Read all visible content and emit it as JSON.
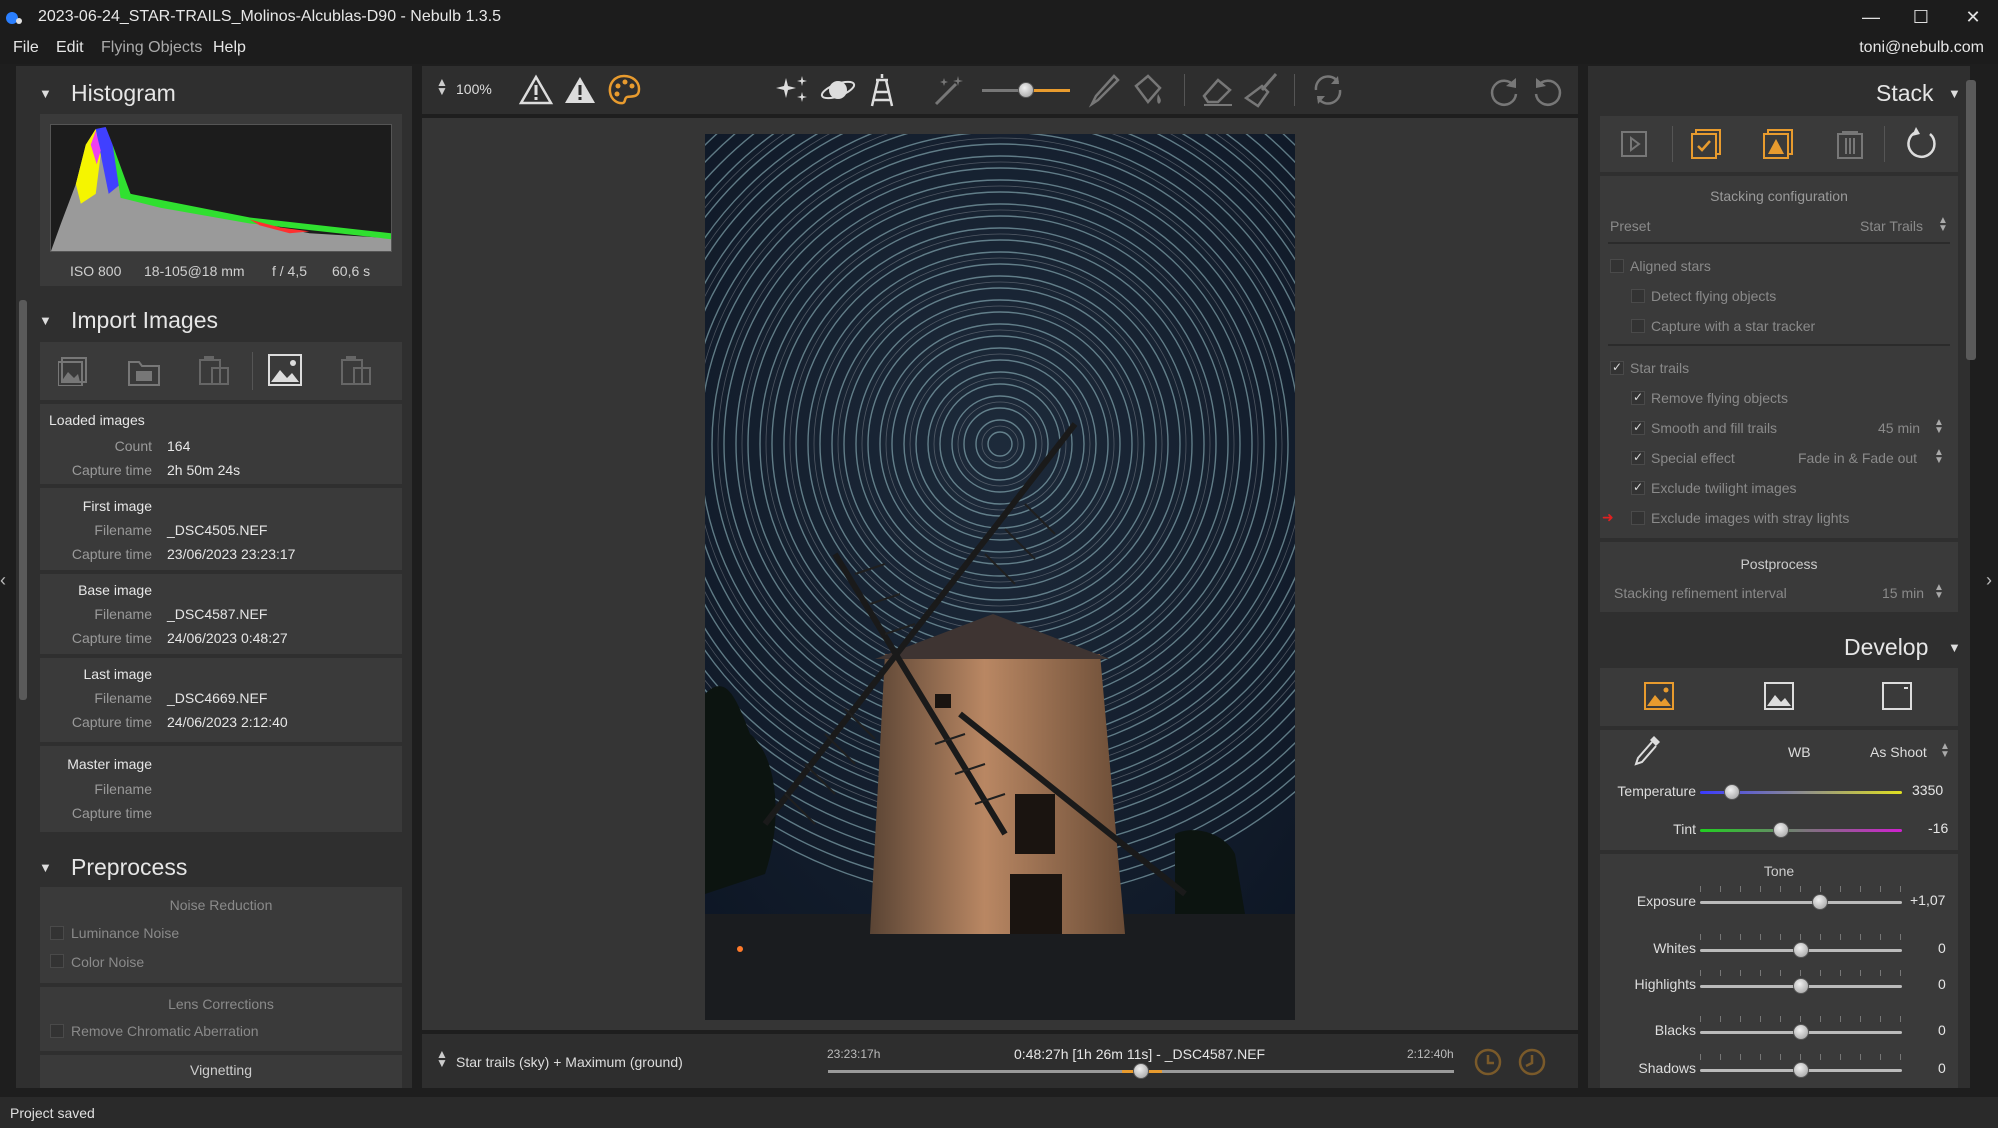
{
  "window": {
    "title": "2023-06-24_STAR-TRAILS_Molinos-Alcublas-D90 - Nebulb 1.3.5",
    "minimize": "—",
    "maximize": "☐",
    "close": "✕"
  },
  "menu": {
    "items": [
      "File",
      "Edit",
      "Flying Objects",
      "Help"
    ],
    "user": "toni@nebulb.com"
  },
  "histogram": {
    "title": "Histogram",
    "iso": "ISO 800",
    "lens": "18-105@18 mm",
    "aperture": "f / 4,5",
    "shutter": "60,6 s"
  },
  "import": {
    "title": "Import Images",
    "loaded_title": "Loaded images",
    "count_label": "Count",
    "count": "164",
    "capture_label": "Capture time",
    "capture": "2h 50m 24s",
    "first_title": "First image",
    "filename_label": "Filename",
    "first_file": "_DSC4505.NEF",
    "first_time": "23/06/2023 23:23:17",
    "base_title": "Base image",
    "base_file": "_DSC4587.NEF",
    "base_time": "24/06/2023 0:48:27",
    "last_title": "Last image",
    "last_file": "_DSC4669.NEF",
    "last_time": "24/06/2023 2:12:40",
    "master_title": "Master image"
  },
  "preprocess": {
    "title": "Preprocess",
    "noise_title": "Noise Reduction",
    "luminance": "Luminance Noise",
    "color_noise": "Color Noise",
    "lens_title": "Lens Corrections",
    "chromatic": "Remove Chromatic Aberration",
    "vignetting": "Vignetting"
  },
  "toolbar": {
    "zoom": "100%"
  },
  "bottom": {
    "mode": "Star trails (sky) + Maximum (ground)",
    "start_time": "23:23:17h",
    "center": "0:48:27h [1h 26m 11s] - _DSC4587.NEF",
    "end_time": "2:12:40h",
    "timeline_position": 0.5
  },
  "stack": {
    "title": "Stack",
    "config_title": "Stacking configuration",
    "preset_label": "Preset",
    "preset_value": "Star Trails",
    "aligned_stars": "Aligned stars",
    "detect_flying": "Detect flying objects",
    "star_tracker": "Capture with a star tracker",
    "star_trails": "Star trails",
    "remove_flying": "Remove flying objects",
    "smooth_fill": "Smooth and fill trails",
    "smooth_value": "45 min",
    "special_effect": "Special effect",
    "special_value": "Fade in & Fade out",
    "exclude_twilight": "Exclude twilight images",
    "exclude_stray": "Exclude images with stray lights",
    "postprocess_title": "Postprocess",
    "refine_label": "Stacking refinement interval",
    "refine_value": "15 min"
  },
  "develop": {
    "title": "Develop",
    "wb_label": "WB",
    "wb_value": "As Shoot",
    "temperature_label": "Temperature",
    "temperature_value": "3350",
    "tint_label": "Tint",
    "tint_value": "-16",
    "tone_title": "Tone",
    "exposure_label": "Exposure",
    "exposure_value": "+1,07",
    "whites_label": "Whites",
    "whites_value": "0",
    "highlights_label": "Highlights",
    "highlights_value": "0",
    "blacks_label": "Blacks",
    "blacks_value": "0",
    "shadows_label": "Shadows",
    "shadows_value": "0"
  },
  "status": {
    "text": "Project saved"
  }
}
